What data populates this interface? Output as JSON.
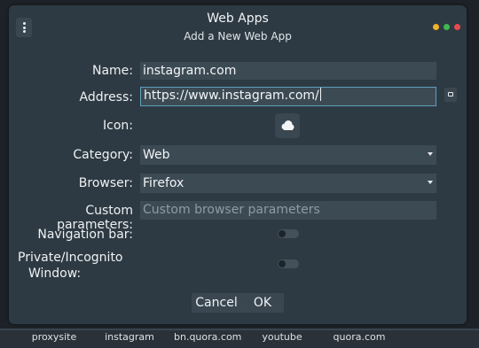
{
  "window": {
    "title": "Web Apps",
    "subtitle": "Add a New Web App"
  },
  "form": {
    "name_label": "Name:",
    "name_value": "instagram.com",
    "address_label": "Address:",
    "address_value": "https://www.instagram.com/",
    "icon_label": "Icon:",
    "category_label": "Category:",
    "category_value": "Web",
    "browser_label": "Browser:",
    "browser_value": "Firefox",
    "custom_label": "Custom parameters:",
    "custom_placeholder": "Custom browser parameters",
    "navbar_label": "Navigation bar:",
    "private_label_line1": "Private/Incognito",
    "private_label_line2": "Window:"
  },
  "buttons": {
    "cancel": "Cancel",
    "ok": "OK"
  },
  "taskbar": {
    "tabs": [
      "proxysite",
      "instagram",
      "bn.quora.com",
      "youtube",
      "quora.com"
    ]
  }
}
